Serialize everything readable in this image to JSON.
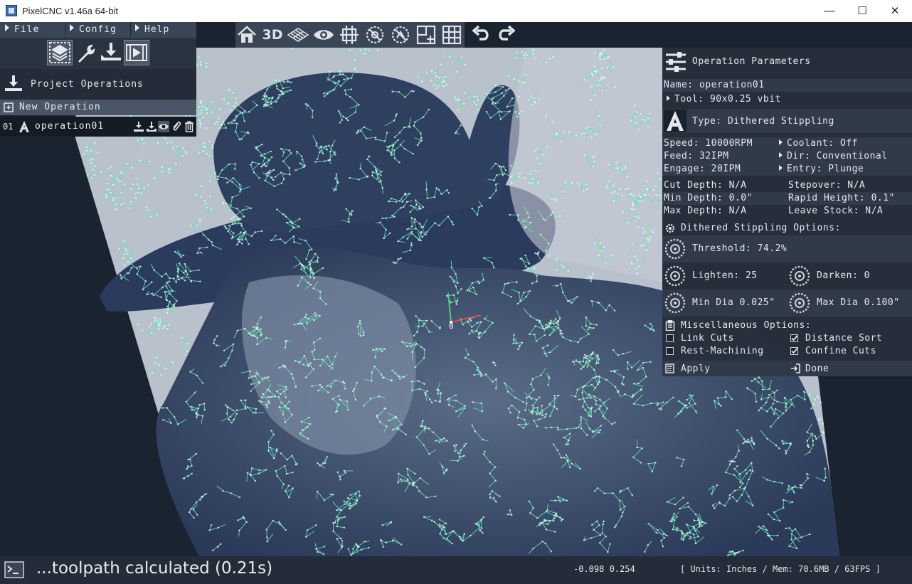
{
  "window": {
    "title": "PixelCNC v1.46a 64-bit",
    "minimize": "—",
    "maximize": "☐",
    "close": "✕"
  },
  "menu": [
    {
      "label": "File"
    },
    {
      "label": "Config"
    },
    {
      "label": "Help"
    }
  ],
  "toolbar": {
    "icons": [
      "home-icon",
      "3d-view-icon",
      "grid-plane-icon",
      "eye-icon",
      "stock-icon",
      "no-tool-icon",
      "no-path-icon",
      "add-image-icon",
      "grid-icon",
      "undo-icon",
      "redo-icon"
    ],
    "label_3d": "3D"
  },
  "tabs": [
    "layers-icon",
    "tool-wrench-icon",
    "operation-icon",
    "simulation-icon"
  ],
  "project": {
    "title": "Project Operations",
    "new_operation": "New Operation"
  },
  "operations": [
    {
      "index": "01",
      "name": "operation01"
    }
  ],
  "panel": {
    "title": "Operation Parameters",
    "name": "Name: operation01",
    "tool": "Tool: 90x0.25 vbit",
    "type": "Type: Dithered Stippling",
    "speed": "Speed: 10000RPM",
    "coolant": "Coolant: Off",
    "feed": "Feed: 32IPM",
    "dir": "Dir: Conventional",
    "engage": "Engage: 20IPM",
    "entry": "Entry: Plunge",
    "cut_depth": "Cut Depth: N/A",
    "stepover": "Stepover: N/A",
    "min_depth": "Min Depth: 0.0\"",
    "rapid_height": "Rapid Height: 0.1\"",
    "max_depth": "Max Depth: N/A",
    "leave_stock": "Leave Stock: N/A",
    "options_title": "Dithered Stippling Options:",
    "threshold": "Threshold: 74.2%",
    "lighten": "Lighten: 25",
    "darken": "Darken: 0",
    "min_dia": "Min Dia 0.025\"",
    "max_dia": "Max Dia 0.100\"",
    "misc_title": "Miscellaneous Options:",
    "link_cuts": {
      "label": "Link Cuts",
      "checked": false
    },
    "distance_sort": {
      "label": "Distance Sort",
      "checked": true
    },
    "rest_machining": {
      "label": "Rest-Machining",
      "checked": false
    },
    "confine_cuts": {
      "label": "Confine Cuts",
      "checked": true
    },
    "apply": "Apply",
    "done": "Done"
  },
  "viewport": {
    "origin_label": "0",
    "path_color": "#5fe7b4"
  },
  "status": {
    "message": "...toolpath calculated (0.21s)",
    "coords": "-0.098  0.254",
    "units": "[ Units: Inches / Mem: 70.6MB / 63FPS ]"
  }
}
